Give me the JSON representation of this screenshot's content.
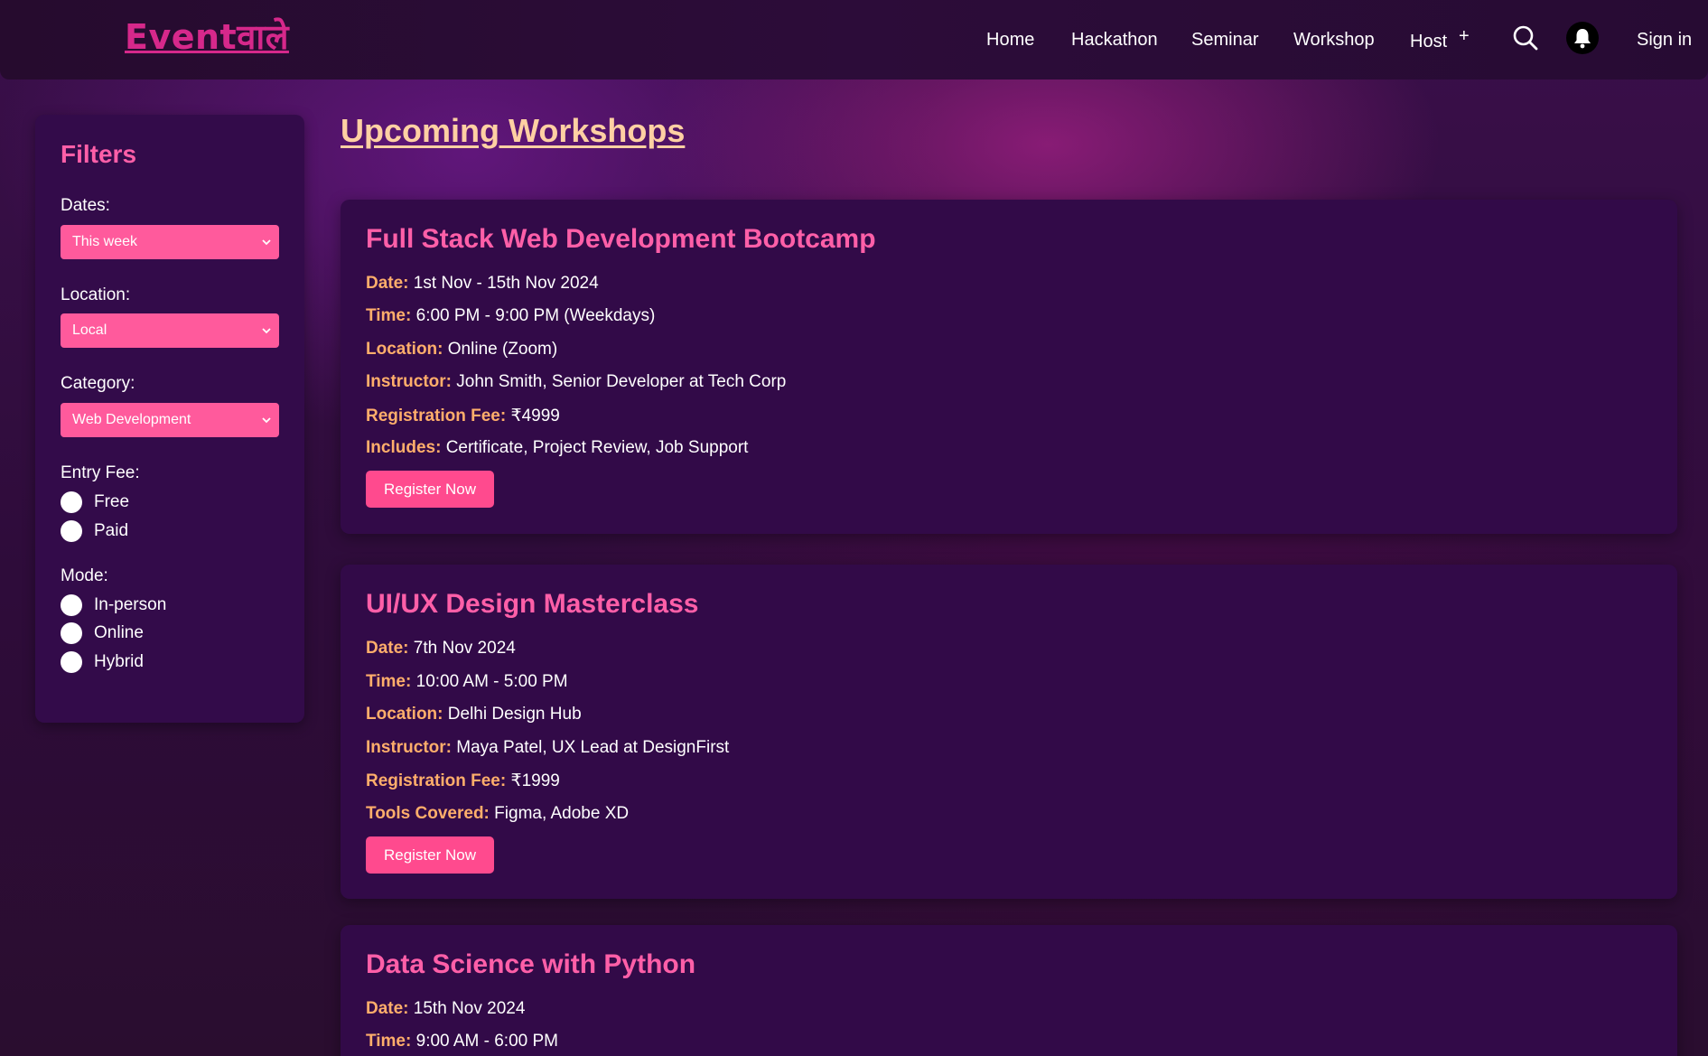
{
  "header": {
    "logo": "Eventवाले",
    "nav": [
      {
        "label": "Home"
      },
      {
        "label": "Hackathon"
      },
      {
        "label": "Seminar"
      },
      {
        "label": "Workshop"
      },
      {
        "label": "Host"
      }
    ],
    "host_plus": "+",
    "search_icon": "search-icon",
    "bell_icon": "bell-icon",
    "signin": "Sign in"
  },
  "filters": {
    "title": "Filters",
    "dates_label": "Dates:",
    "dates_value": "This week",
    "location_label": "Location:",
    "location_value": "Local",
    "category_label": "Category:",
    "category_value": "Web Development",
    "fee_label": "Entry Fee:",
    "fee_options": [
      "Free",
      "Paid"
    ],
    "mode_label": "Mode:",
    "mode_options": [
      "In-person",
      "Online",
      "Hybrid"
    ]
  },
  "main": {
    "title": "Upcoming Workshops",
    "register_label": "Register Now",
    "workshops": [
      {
        "title": "Full Stack Web Development Bootcamp",
        "details": [
          {
            "k": "Date:",
            "v": "1st Nov - 15th Nov 2024"
          },
          {
            "k": "Time:",
            "v": "6:00 PM - 9:00 PM (Weekdays)"
          },
          {
            "k": "Location:",
            "v": "Online (Zoom)"
          },
          {
            "k": "Instructor:",
            "v": "John Smith, Senior Developer at Tech Corp"
          },
          {
            "k": "Registration Fee:",
            "v": "₹4999"
          },
          {
            "k": "Includes:",
            "v": "Certificate, Project Review, Job Support"
          }
        ]
      },
      {
        "title": "UI/UX Design Masterclass",
        "details": [
          {
            "k": "Date:",
            "v": "7th Nov 2024"
          },
          {
            "k": "Time:",
            "v": "10:00 AM - 5:00 PM"
          },
          {
            "k": "Location:",
            "v": "Delhi Design Hub"
          },
          {
            "k": "Instructor:",
            "v": "Maya Patel, UX Lead at DesignFirst"
          },
          {
            "k": "Registration Fee:",
            "v": "₹1999"
          },
          {
            "k": "Tools Covered:",
            "v": "Figma, Adobe XD"
          }
        ]
      },
      {
        "title": "Data Science with Python",
        "details": [
          {
            "k": "Date:",
            "v": "15th Nov 2024"
          },
          {
            "k": "Time:",
            "v": "9:00 AM - 6:00 PM"
          }
        ]
      }
    ]
  },
  "colors": {
    "accent_pink": "#ff5fa8",
    "button_pink": "#ff4a8e",
    "label_orange": "#ffae6b",
    "title_peach": "#ffd0a3",
    "card_bg": "#320a48"
  }
}
